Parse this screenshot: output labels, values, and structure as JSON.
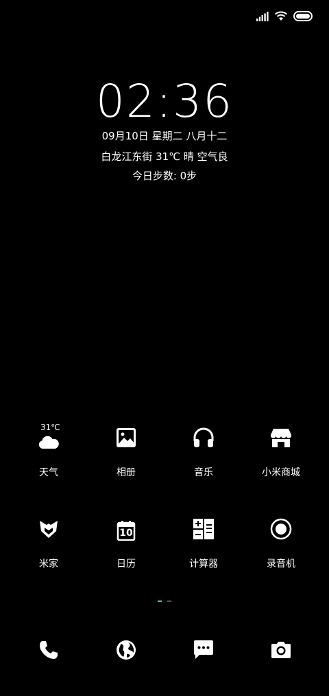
{
  "status_bar": {
    "icons": [
      "signal-icon",
      "wifi-icon",
      "battery-icon"
    ]
  },
  "lockscreen": {
    "time": "02:36",
    "date_line": "09月10日 星期二 八月十二",
    "weather_line": "白龙江东街 31℃ 晴 空气良",
    "steps_line": "今日步数: 0步"
  },
  "apps": {
    "weather": {
      "label": "天气",
      "temp": "31℃",
      "icon": "cloud-icon"
    },
    "gallery": {
      "label": "相册",
      "icon": "image-icon"
    },
    "music": {
      "label": "音乐",
      "icon": "headphones-icon"
    },
    "mistore": {
      "label": "小米商城",
      "icon": "store-icon"
    },
    "mihome": {
      "label": "米家",
      "icon": "mi-home-icon"
    },
    "calendar": {
      "label": "日历",
      "day": "10",
      "icon": "calendar-icon"
    },
    "calculator": {
      "label": "计算器",
      "icon": "calculator-icon"
    },
    "recorder": {
      "label": "录音机",
      "icon": "record-icon"
    }
  },
  "pager": {
    "pages": 2,
    "active": 1
  },
  "dock": [
    "phone-icon",
    "browser-icon",
    "messages-icon",
    "camera-icon"
  ],
  "colors": {
    "background": "#000000",
    "foreground": "#ffffff",
    "pager_active": "#2ad0d8"
  }
}
